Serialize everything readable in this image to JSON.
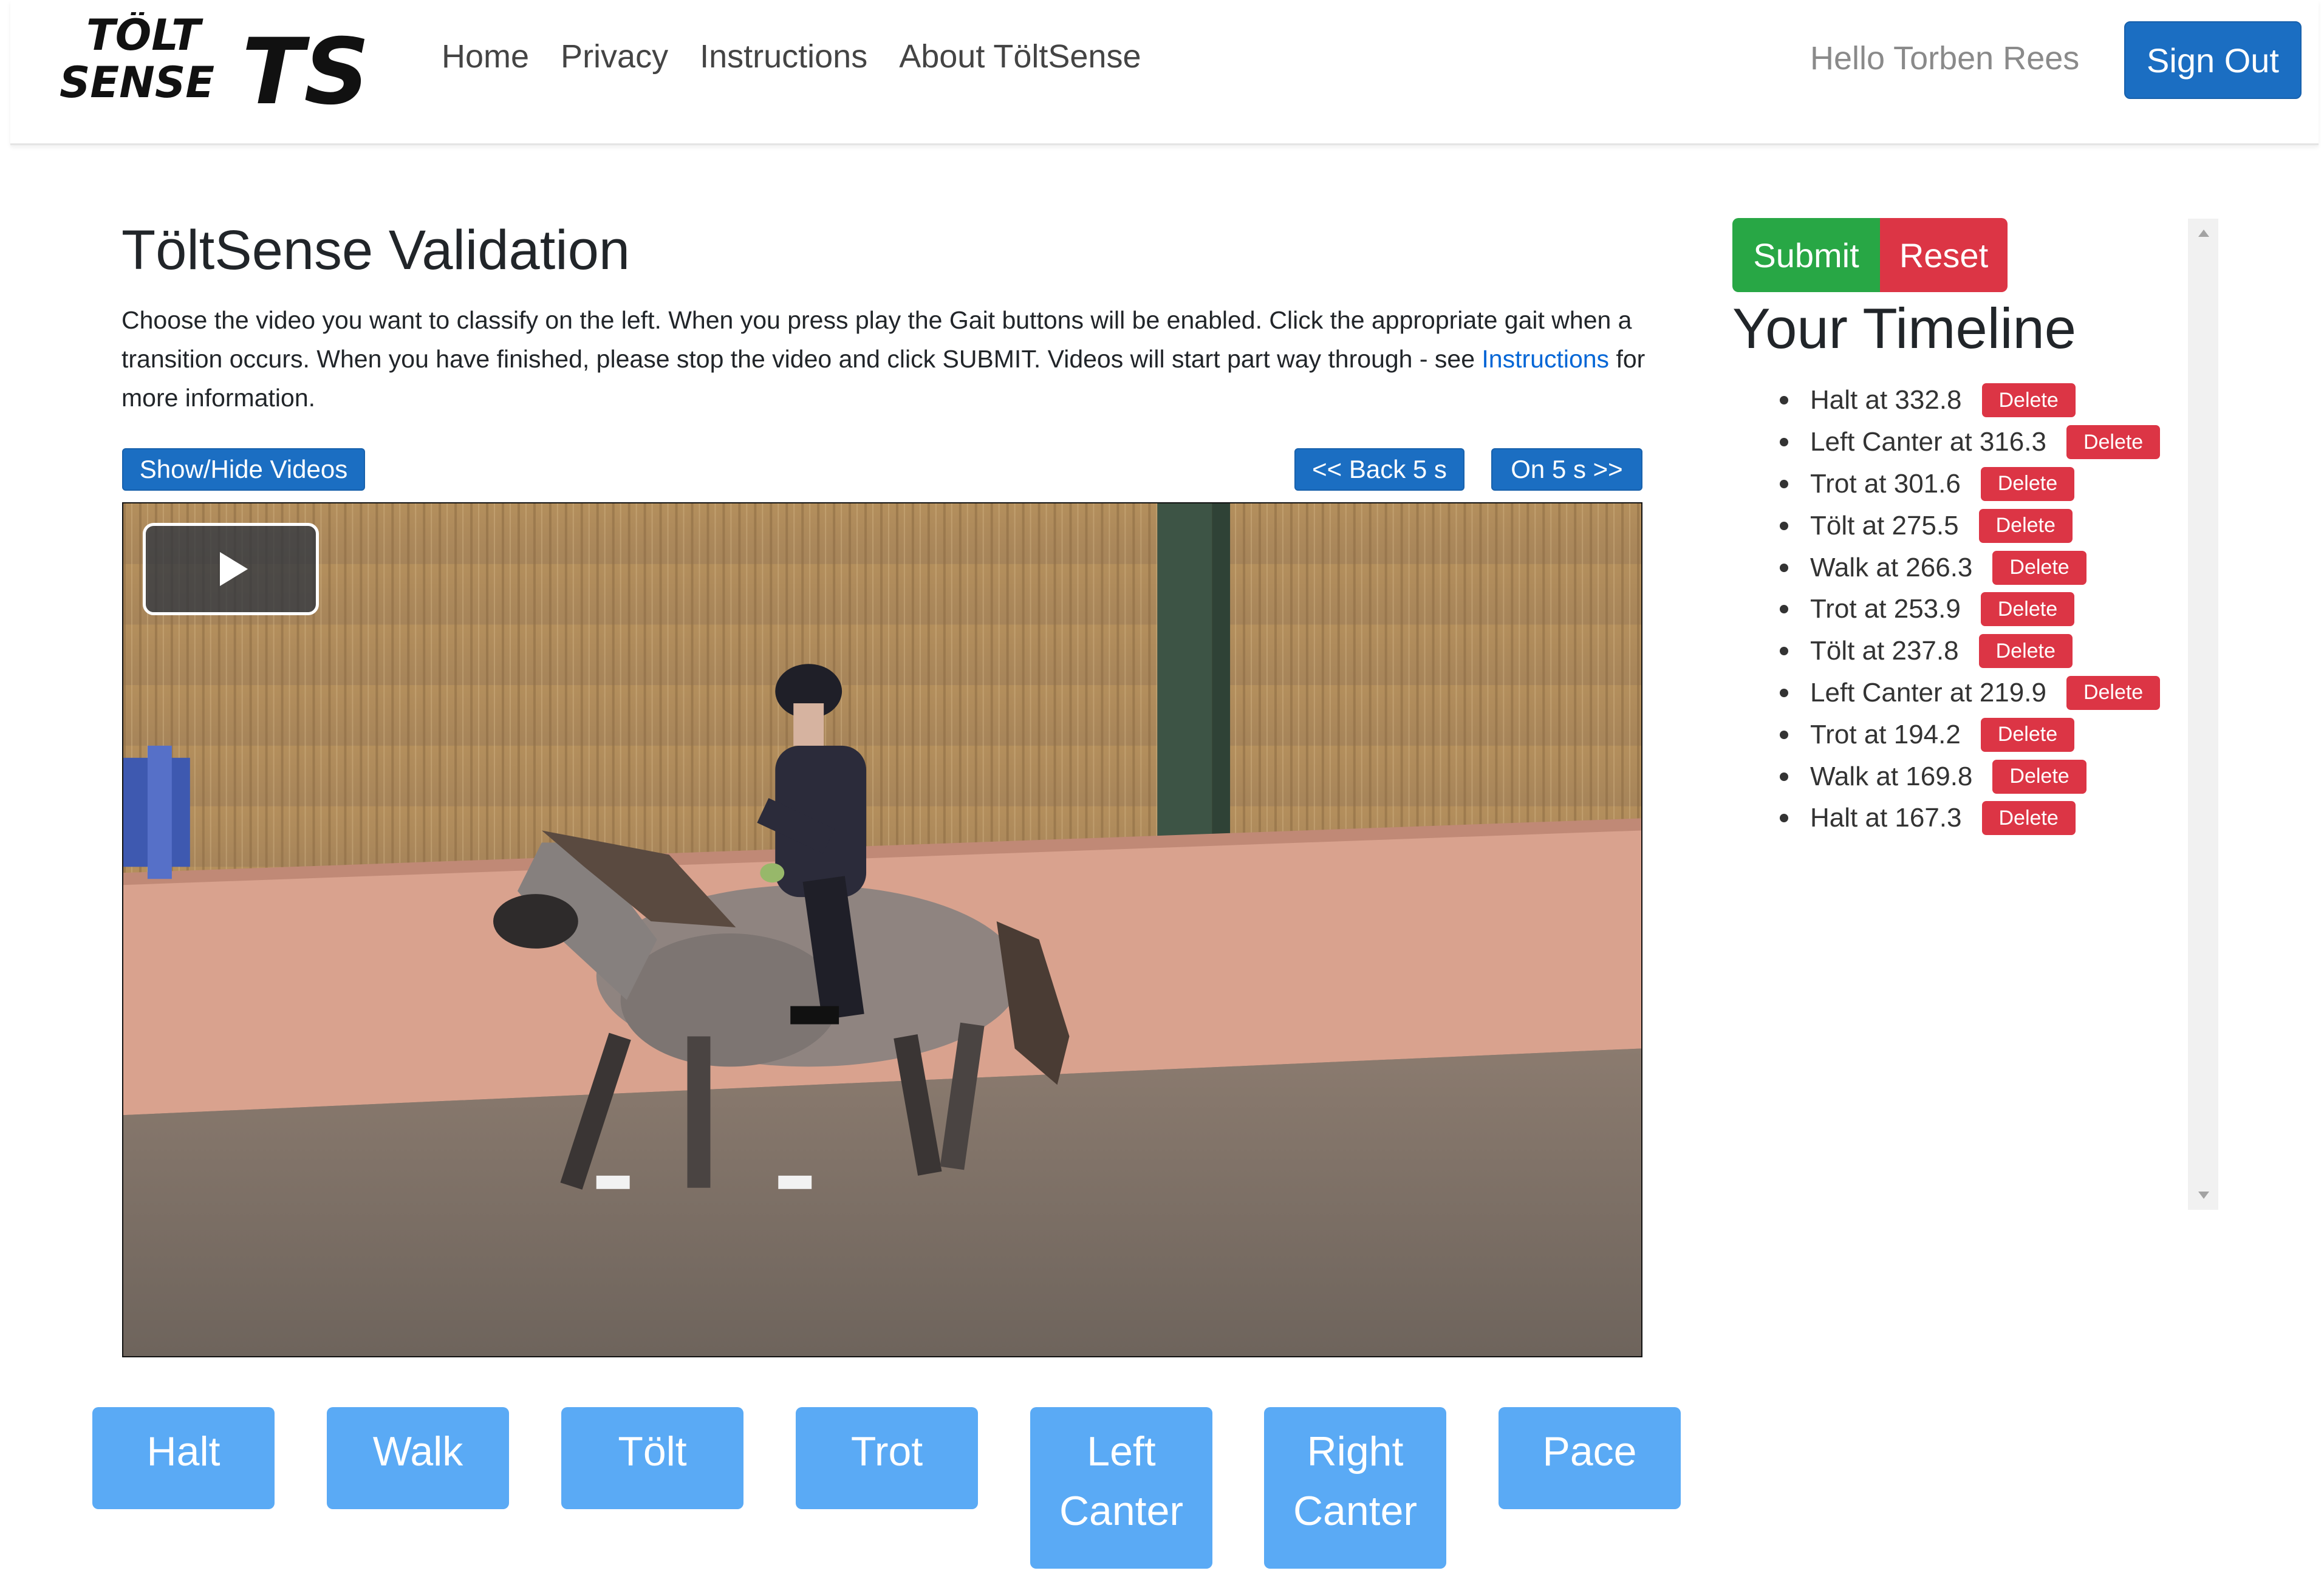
{
  "nav": {
    "logo_text_line1": "TÖLT",
    "logo_text_line2": "SENSE",
    "logo_mark": "TS",
    "links": [
      "Home",
      "Privacy",
      "Instructions",
      "About TöltSense"
    ],
    "greeting": "Hello Torben Rees",
    "signout_label": "Sign Out"
  },
  "main": {
    "title": "TöltSense Validation",
    "intro_text": "Choose the video you want to classify on the left. When you press play the Gait buttons will be enabled. Click the appropriate gait when a transition occurs. When you have finished, please stop the video and click SUBMIT. Videos will start part way through - see ",
    "intro_link": "Instructions",
    "intro_suffix": " for more information.",
    "show_hide_label": "Show/Hide Videos",
    "back_label": "<< Back 5 s",
    "on_label": "On 5 s >>",
    "play_icon": "play-icon"
  },
  "gaits": [
    {
      "label_1": "Halt",
      "label_2": ""
    },
    {
      "label_1": "Walk",
      "label_2": ""
    },
    {
      "label_1": "Tölt",
      "label_2": ""
    },
    {
      "label_1": "Trot",
      "label_2": ""
    },
    {
      "label_1": "Left",
      "label_2": "Canter"
    },
    {
      "label_1": "Right",
      "label_2": "Canter"
    },
    {
      "label_1": "Pace",
      "label_2": ""
    }
  ],
  "timeline": {
    "submit_label": "Submit",
    "reset_label": "Reset",
    "title": "Your Timeline",
    "delete_label": "Delete",
    "items": [
      "Halt at 332.8",
      "Left Canter at 316.3",
      "Trot at 301.6",
      "Tölt at 275.5",
      "Walk at 266.3",
      "Trot at 253.9",
      "Tölt at 237.8",
      "Left Canter at 219.9",
      "Trot at 194.2",
      "Walk at 169.8",
      "Halt at 167.3"
    ]
  },
  "colors": {
    "primary": "#1b6ec2",
    "gait_button": "#5aaaf5",
    "success": "#28a745",
    "danger": "#dc3545",
    "link": "#0366d6"
  }
}
